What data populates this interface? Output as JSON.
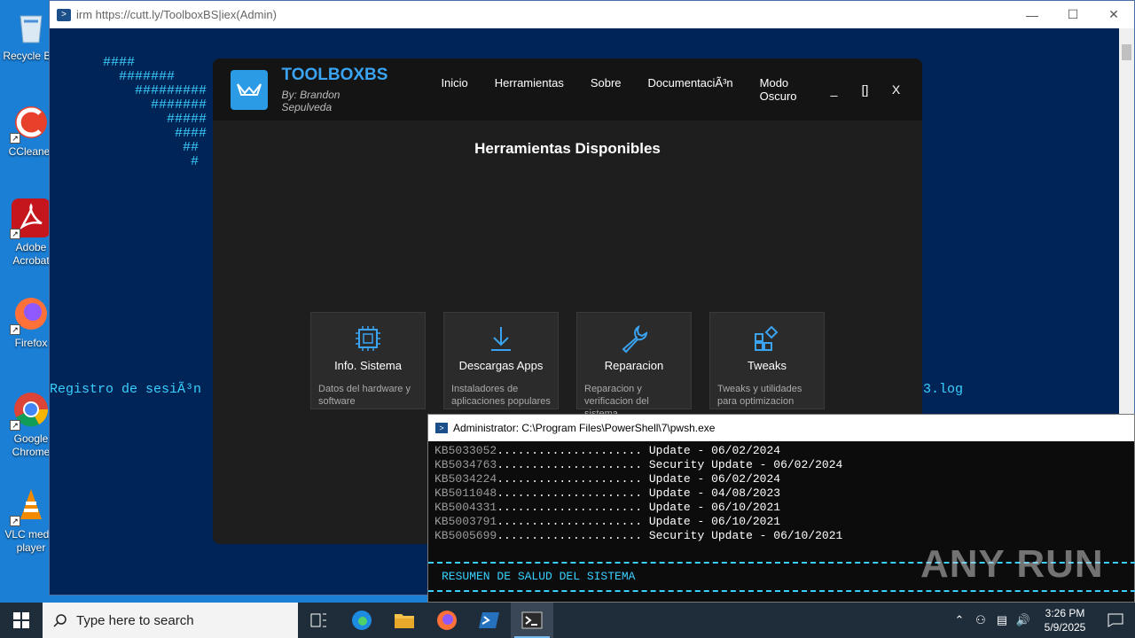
{
  "desktop": {
    "icons": [
      {
        "label": "Recycle Bin"
      },
      {
        "label": "CCleaner"
      },
      {
        "label": "Adobe Acrobat"
      },
      {
        "label": "Firefox"
      },
      {
        "label": "Google Chrome"
      },
      {
        "label": "VLC media player"
      }
    ]
  },
  "back_window": {
    "title": "irm https://cutt.ly/ToolboxBS|iex(Admin)",
    "ascii_lines": [
      "####",
      "  #######",
      "    #########",
      "      #######",
      "        #####",
      "         ####",
      "          ##",
      "           #"
    ],
    "log_line_left": "Registro de sesiÃ³n",
    "log_line_right": "3.log"
  },
  "toolbox": {
    "brand": "TOOLBOXBS",
    "by": "By: Brandon Sepulveda",
    "nav": [
      "Inicio",
      "Herramientas",
      "Sobre",
      "DocumentaciÃ³n",
      "Modo Oscuro"
    ],
    "controls": [
      "_",
      "[]",
      "X"
    ],
    "title": "Herramientas Disponibles",
    "cards": [
      {
        "title": "Info. Sistema",
        "desc": "Datos del hardware y software",
        "icon": "chip-icon"
      },
      {
        "title": "Descargas Apps",
        "desc": "Instaladores de aplicaciones populares",
        "icon": "download-icon"
      },
      {
        "title": "Reparacion",
        "desc": "Reparacion y verificacion del sistema",
        "icon": "wrench-icon"
      },
      {
        "title": "Tweaks",
        "desc": "Tweaks y utilidades para optimizacion",
        "icon": "tweaks-icon"
      }
    ]
  },
  "pwsh": {
    "title": "Administrator: C:\\Program Files\\PowerShell\\7\\pwsh.exe",
    "lines": [
      {
        "kb": "KB5033052",
        "dots": "..................... ",
        "text": "Update - 06/02/2024"
      },
      {
        "kb": "KB5034763",
        "dots": "..................... ",
        "text": "Security Update - 06/02/2024"
      },
      {
        "kb": "KB5034224",
        "dots": "..................... ",
        "text": "Update - 06/02/2024"
      },
      {
        "kb": "KB5011048",
        "dots": "..................... ",
        "text": "Update - 04/08/2023"
      },
      {
        "kb": "KB5004331",
        "dots": "..................... ",
        "text": "Update - 06/10/2021"
      },
      {
        "kb": "KB5003791",
        "dots": "..................... ",
        "text": "Update - 06/10/2021"
      },
      {
        "kb": "KB5005699",
        "dots": "..................... ",
        "text": "Security Update - 06/10/2021"
      }
    ],
    "summary": "RESUMEN DE SALUD DEL SISTEMA"
  },
  "watermark": "ANY RUN",
  "taskbar": {
    "search_placeholder": "Type here to search",
    "time": "3:26 PM",
    "date": "5/9/2025"
  }
}
